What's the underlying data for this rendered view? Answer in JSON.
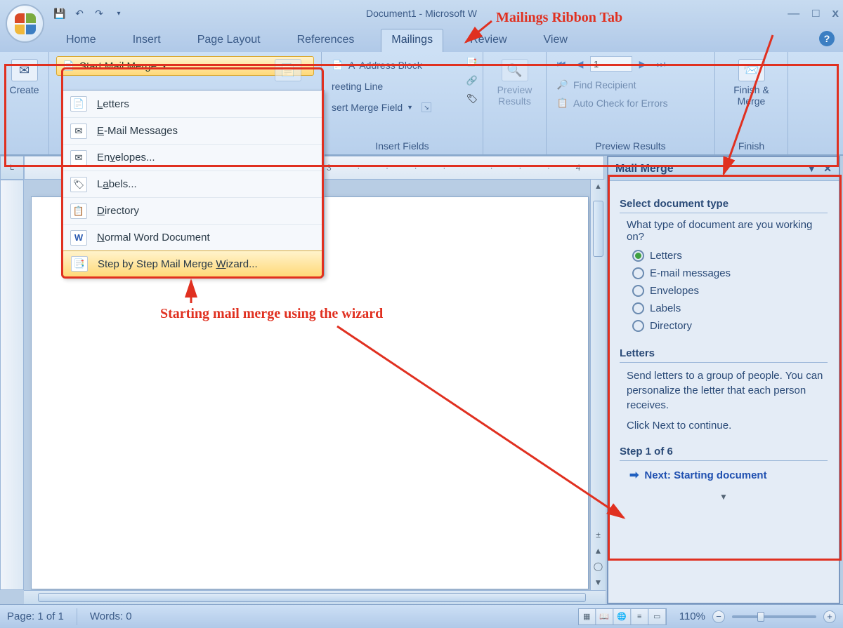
{
  "window": {
    "title": "Document1 - Microsoft W"
  },
  "tabs": {
    "home": "Home",
    "insert": "Insert",
    "page_layout": "Page Layout",
    "references": "References",
    "mailings": "Mailings",
    "review": "Review",
    "view": "View"
  },
  "ribbon": {
    "create": "Create",
    "start_mail_merge": "Start Mail Merge",
    "address_block": "Address Block",
    "greeting_line": "reeting Line",
    "insert_merge_field": "sert Merge Field",
    "insert_fields_label": "Insert Fields",
    "preview_results": "Preview\nResults",
    "preview_results_label": "Preview Results",
    "record_value": "1",
    "find_recipient": "Find Recipient",
    "auto_check": "Auto Check for Errors",
    "finish_merge": "Finish &\nMerge",
    "finish_label": "Finish"
  },
  "dropdown": {
    "letters": "Letters",
    "email": "E-Mail Messages",
    "envelopes": "Envelopes...",
    "labels": "Labels...",
    "directory": "Directory",
    "normal": "Normal Word Document",
    "wizard": "Step by Step Mail Merge Wizard..."
  },
  "ruler": "3  ·  ·  ·  ·    ·  ·  ·  4  ·  ·",
  "taskpane": {
    "title": "Mail Merge",
    "h1": "Select document type",
    "q": "What type of document are you working on?",
    "opts": {
      "letters": "Letters",
      "email": "E-mail messages",
      "envelopes": "Envelopes",
      "labels": "Labels",
      "directory": "Directory"
    },
    "h2": "Letters",
    "desc": "Send letters to a group of people. You can personalize the letter that each person receives.",
    "cont": "Click Next to continue.",
    "step": "Step 1 of 6",
    "next": "Next: Starting document"
  },
  "status": {
    "page": "Page: 1 of 1",
    "words": "Words: 0",
    "zoom": "110%"
  },
  "annotations": {
    "tab": "Mailings Ribbon Tab",
    "wizard": "Starting mail merge using the wizard"
  }
}
